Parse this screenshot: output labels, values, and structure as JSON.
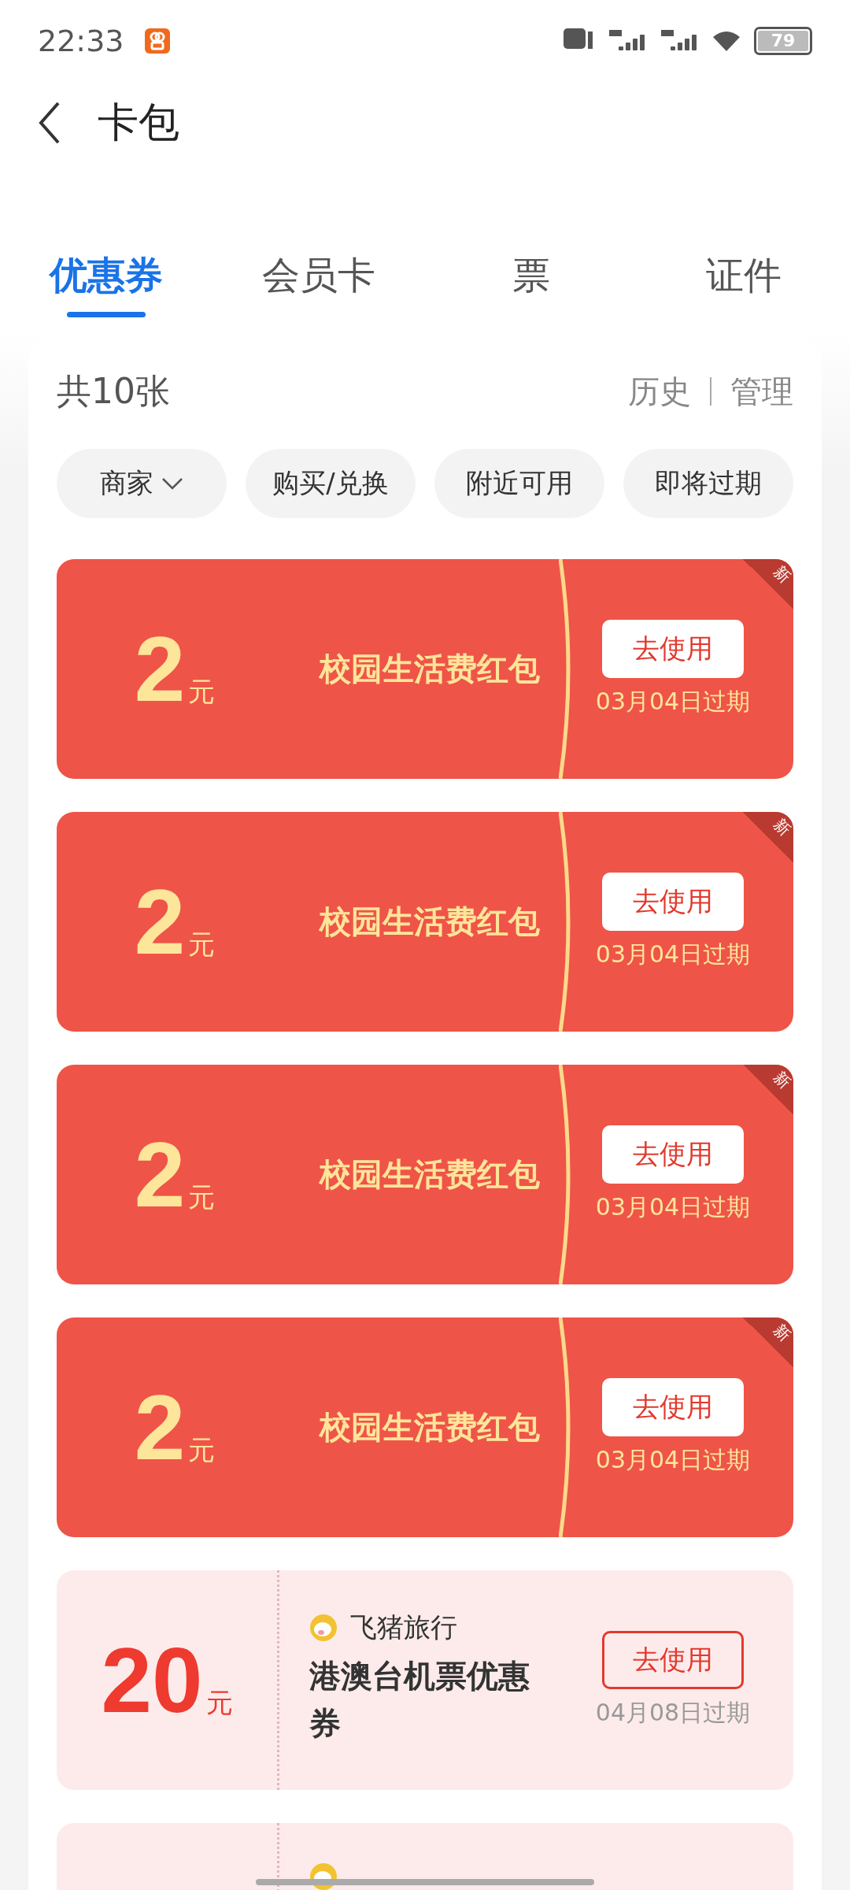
{
  "status_bar": {
    "time": "22:33",
    "battery": "79"
  },
  "header": {
    "title": "卡包"
  },
  "tabs": [
    {
      "label": "优惠券",
      "selected": true
    },
    {
      "label": "会员卡",
      "selected": false
    },
    {
      "label": "票",
      "selected": false
    },
    {
      "label": "证件",
      "selected": false
    }
  ],
  "summary": {
    "count": "共10张",
    "links": [
      "历史",
      "管理"
    ]
  },
  "filters": [
    {
      "label": "商家",
      "dropdown": true
    },
    {
      "label": "购买/兑换",
      "dropdown": false
    },
    {
      "label": "附近可用",
      "dropdown": false
    },
    {
      "label": "即将过期",
      "dropdown": false
    }
  ],
  "coupons": [
    {
      "kind": "red",
      "amount": "2",
      "unit": "元",
      "title": "校园生活费红包",
      "button": "去使用",
      "expiry": "03月04日过期",
      "badge": "新"
    },
    {
      "kind": "red",
      "amount": "2",
      "unit": "元",
      "title": "校园生活费红包",
      "button": "去使用",
      "expiry": "03月04日过期",
      "badge": "新"
    },
    {
      "kind": "red",
      "amount": "2",
      "unit": "元",
      "title": "校园生活费红包",
      "button": "去使用",
      "expiry": "03月04日过期",
      "badge": "新"
    },
    {
      "kind": "red",
      "amount": "2",
      "unit": "元",
      "title": "校园生活费红包",
      "button": "去使用",
      "expiry": "03月04日过期",
      "badge": "新"
    },
    {
      "kind": "merchant",
      "amount": "20",
      "unit": "元",
      "merchant": "飞猪旅行",
      "title": "港澳台机票优惠券",
      "button": "去使用",
      "expiry": "04月08日过期"
    },
    {
      "kind": "merchant"
    }
  ]
}
